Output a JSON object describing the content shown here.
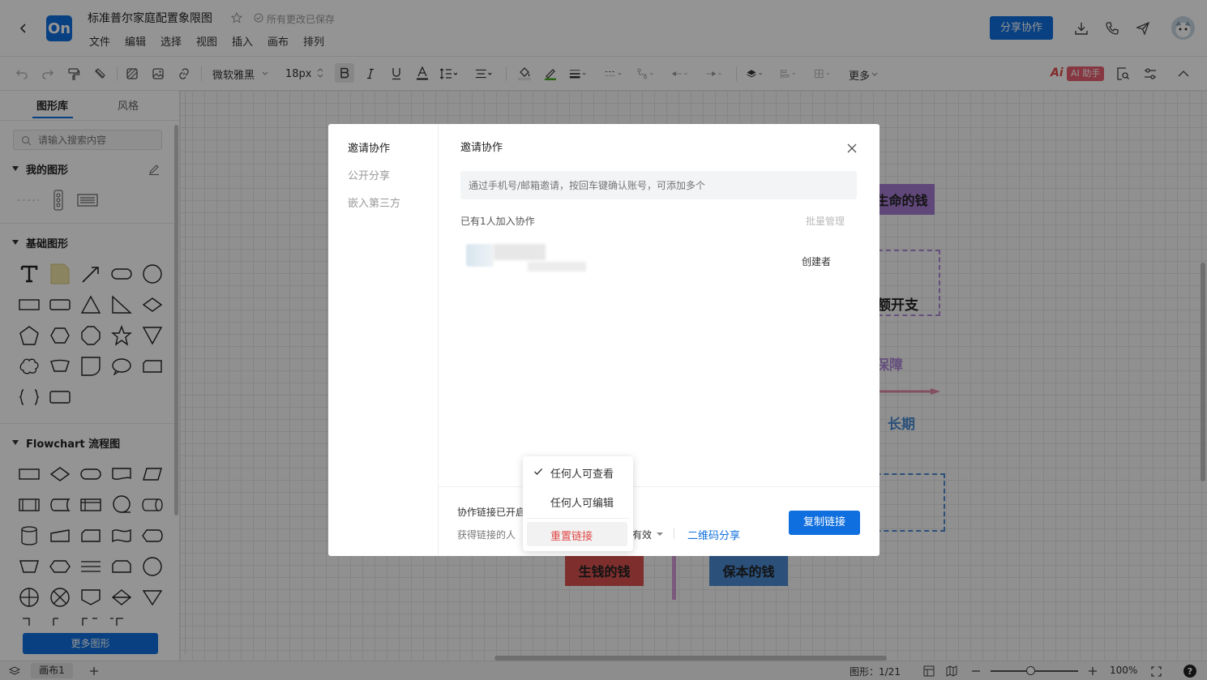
{
  "app": {
    "logo": "On",
    "title": "标准普尔家庭配置象限图",
    "save_status": "所有更改已保存",
    "share_button": "分享协作"
  },
  "menu": [
    "文件",
    "编辑",
    "选择",
    "视图",
    "插入",
    "画布",
    "排列"
  ],
  "toolbar": {
    "font_family": "微软雅黑",
    "font_size": "18px",
    "more": "更多",
    "ai_badge": "AI 助手"
  },
  "sidebar": {
    "tabs": [
      "图形库",
      "风格"
    ],
    "search_placeholder": "请输入搜索内容",
    "sections": [
      "我的图形",
      "基础图形",
      "Flowchart 流程图"
    ],
    "more_shapes": "更多图形"
  },
  "canvas": {
    "labels": [
      "生命的钱",
      "额开支",
      "保障",
      "长期",
      "生钱的钱",
      "保本的钱"
    ]
  },
  "statusbar": {
    "page_tab": "画布1",
    "shape_count": "图形：1/21",
    "zoom": "100%"
  },
  "dialog": {
    "nav": [
      "邀请协作",
      "公开分享",
      "嵌入第三方"
    ],
    "title": "邀请协作",
    "invite_placeholder": "通过手机号/邮箱邀请，按回车键确认账号，可添加多个",
    "members_count": "已有1人加入协作",
    "batch_manage": "批量管理",
    "member_role": "创建者",
    "link_status": "协作链接已开启",
    "link_people_label": "获得链接的人",
    "link_validity": "有效",
    "qr_share": "二维码分享",
    "copy_link": "复制链接"
  },
  "dropdown": {
    "options": [
      "任何人可查看",
      "任何人可编辑"
    ],
    "selected": "任何人可查看",
    "reset": "重置链接"
  },
  "colors": {
    "primary": "#0f6fde",
    "danger": "#e04848",
    "canvas_red": "#d9524f",
    "canvas_blue": "#4a8ad2",
    "canvas_purple": "#a67bd2"
  }
}
